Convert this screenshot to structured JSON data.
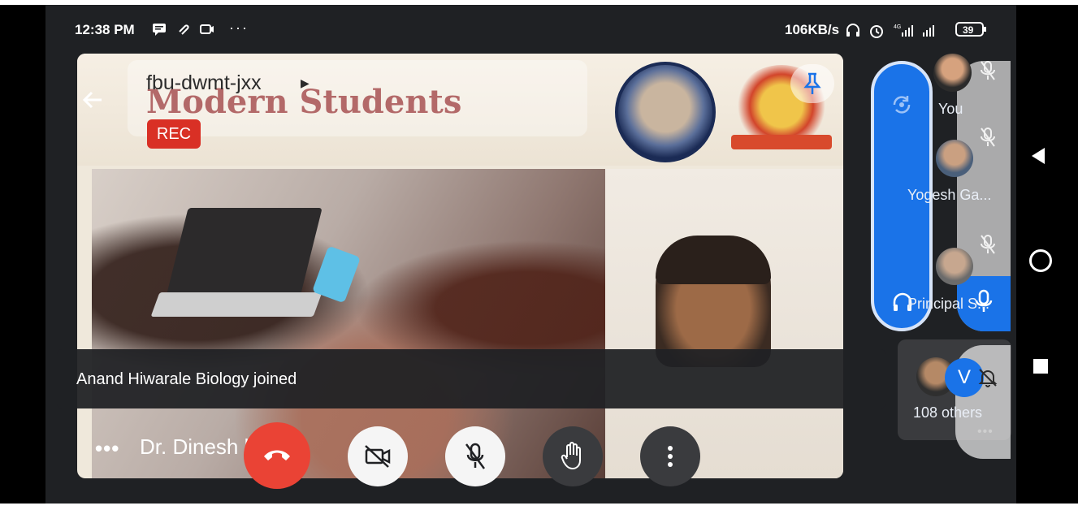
{
  "status_bar": {
    "time": "12:38 PM",
    "net_speed": "106KB/s",
    "battery": "39"
  },
  "meeting": {
    "code": "fbu-dwmt-jxx",
    "rec_label": "REC",
    "banner_text": "Modern Students"
  },
  "toast": {
    "message": "Anand Hiwarale Biology joined"
  },
  "current_tile": {
    "more_dots": "•••",
    "name": "Dr. Dinesh kar"
  },
  "participants": [
    {
      "name": "You"
    },
    {
      "name": "Yogesh Ga..."
    },
    {
      "name": "Principal S..."
    }
  ],
  "others": {
    "initial": "V",
    "count_label": "108 others",
    "dots": "•••"
  },
  "icons": {
    "back": "arrow-back-icon",
    "pin": "pin-icon",
    "end_call": "call-end-icon",
    "camera": "camera-off-icon",
    "mic": "mic-off-icon",
    "hand": "hand-raise-icon",
    "more": "more-vert-icon",
    "rotate": "rotate-camera-icon",
    "headphones": "headphones-icon",
    "mic_on": "mic-icon"
  },
  "colors": {
    "end_call": "#ea4335",
    "rec": "#d93025",
    "accent_blue": "#1a73e8",
    "toast_bg": "#202124"
  }
}
